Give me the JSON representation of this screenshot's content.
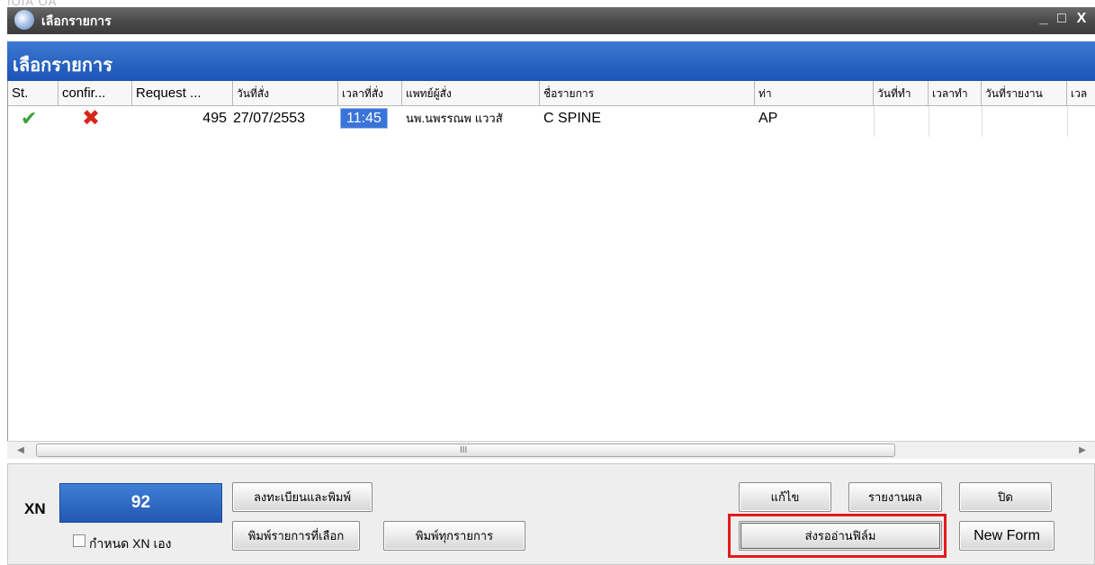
{
  "window": {
    "title": "เลือกรายการ",
    "ghost_title": "ÌÒÌÀ ÔÃ",
    "minimize_label": "_",
    "maximize_label": "□",
    "close_label": "X"
  },
  "header": {
    "title": "เลือกรายการ"
  },
  "table": {
    "columns": [
      "St.",
      "confir...",
      "Request ...",
      "วันที่สั่ง",
      "เวลาที่สั่ง",
      "แพทย์ผู้สั่ง",
      "ชื่อรายการ",
      "ท่า",
      "วันที่ทำ",
      "เวลาทำ",
      "วันที่รายงาน",
      "เวล"
    ],
    "rows": [
      {
        "status_icon": "✔",
        "confirm_icon": "✖",
        "request": "495",
        "order_date": "27/07/2553",
        "order_time": "11:45",
        "doctor": "นพ.นพรรณพ แววสั",
        "item_name": "C SPINE",
        "position": "AP",
        "done_date": "",
        "done_time": "",
        "report_date": "",
        "report_time": ""
      }
    ]
  },
  "scrollbar": {
    "left_arrow": "◀",
    "right_arrow": "▶",
    "grip": "III"
  },
  "footer": {
    "xn_label": "XN",
    "xn_value": "92",
    "manual_xn_label": "กำหนด XN เอง",
    "buttons": {
      "register_print": "ลงทะเบียนและพิมพ์",
      "print_selected": "พิมพ์รายการที่เลือก",
      "print_all": "พิมพ์ทุกรายการ",
      "edit": "แก้ไข",
      "report": "รายงานผล",
      "close": "ปิด",
      "send_film": "ส่งรออ่านฟิล์ม",
      "new_form": "New Form"
    }
  },
  "colors": {
    "header_blue": "#1b54b5",
    "highlight_red": "#e31b1b",
    "check_green": "#3ba33b",
    "cross_red": "#d8261b"
  }
}
